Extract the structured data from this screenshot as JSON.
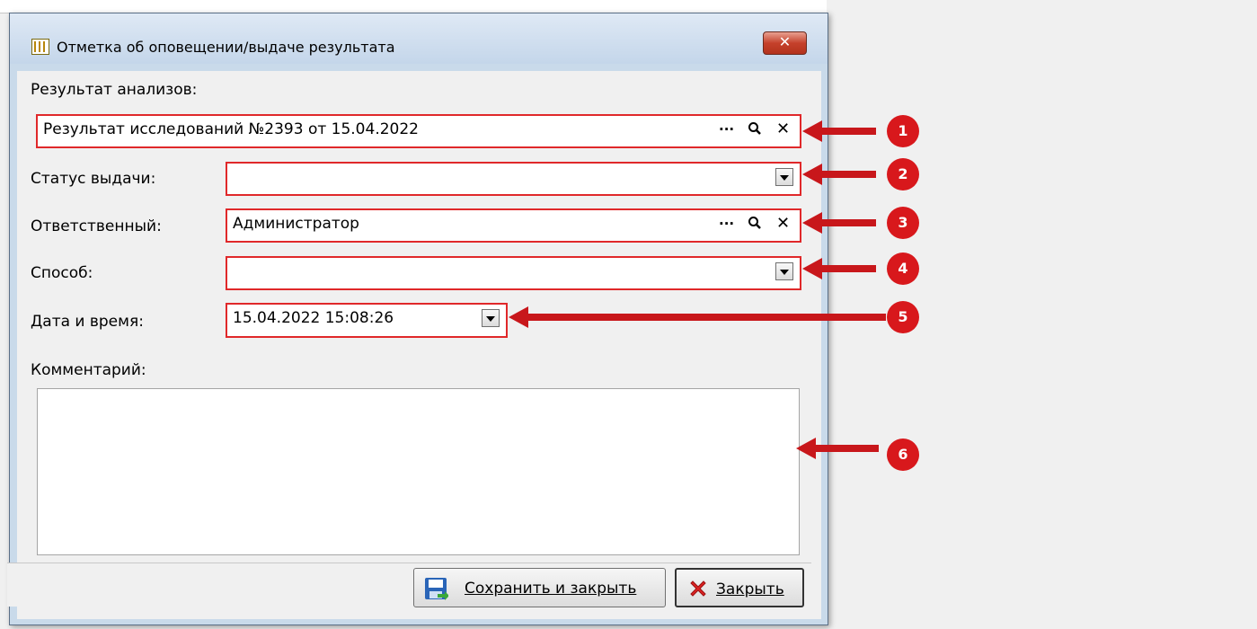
{
  "window": {
    "title": "Отметка об оповещении/выдаче результата",
    "close_label": "✕"
  },
  "form": {
    "result_label": "Результат анализов:",
    "result_value": "Результат исследований №2393 от 15.04.2022",
    "status_label": "Статус выдачи:",
    "status_value": "",
    "responsible_label": "Ответственный:",
    "responsible_value": "Администратор",
    "method_label": "Способ:",
    "method_value": "",
    "datetime_label": "Дата и время:",
    "datetime_value": "15.04.2022 15:08:26",
    "comment_label": "Комментарий:",
    "comment_value": ""
  },
  "field_buttons": {
    "ellipsis": "···",
    "search": "🔍",
    "clear": "✕"
  },
  "buttons": {
    "save_close": "Сохранить и закрыть",
    "close": "Закрыть"
  },
  "callouts": [
    "1",
    "2",
    "3",
    "4",
    "5",
    "6"
  ],
  "colors": {
    "callout_red": "#d8181c",
    "highlight_border": "#e0282a",
    "titlebar": "#c9daea"
  }
}
